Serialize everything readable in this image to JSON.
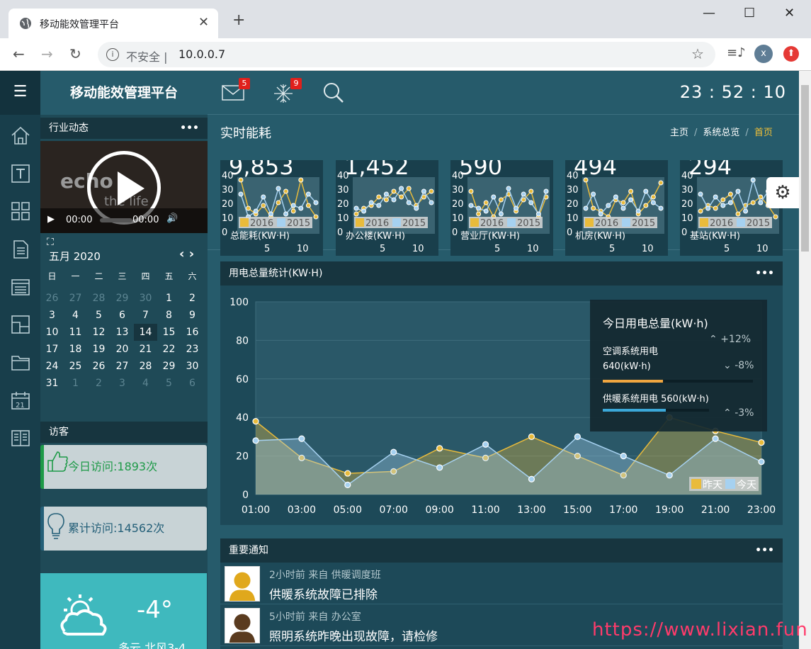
{
  "browser": {
    "tab_title": "移动能效管理平台",
    "insecure": "不安全",
    "url": "10.0.0.7",
    "avatar_initial": "x"
  },
  "app": {
    "brand": "移动能效管理平台",
    "clock": "23 : 52 : 10",
    "mail_badge": "5",
    "snow_badge": "9"
  },
  "page": {
    "title": "实时能耗",
    "breadcrumbs": [
      "主页",
      "系统总览",
      "首页"
    ]
  },
  "news": {
    "title": "行业动态",
    "video_time": "00:00",
    "video_duration": "00:00",
    "video_text": [
      "echo",
      "the life"
    ]
  },
  "calendar": {
    "month": "五月 2020",
    "weekdays": [
      "日",
      "一",
      "二",
      "三",
      "四",
      "五",
      "六"
    ],
    "rows": [
      [
        "26",
        "27",
        "28",
        "29",
        "30",
        "1",
        "2"
      ],
      [
        "3",
        "4",
        "5",
        "6",
        "7",
        "8",
        "9"
      ],
      [
        "10",
        "11",
        "12",
        "13",
        "14",
        "15",
        "16"
      ],
      [
        "17",
        "18",
        "19",
        "20",
        "21",
        "22",
        "23"
      ],
      [
        "24",
        "25",
        "26",
        "27",
        "28",
        "29",
        "30"
      ],
      [
        "31",
        "1",
        "2",
        "3",
        "4",
        "5",
        "6"
      ]
    ],
    "today": "14"
  },
  "visitors": {
    "title": "访客",
    "today": "今日访问:1893次",
    "total": "累计访问:14562次"
  },
  "weather": {
    "temp": "-4°",
    "desc": "多云 北风3-4"
  },
  "minis": [
    {
      "value": "9,853",
      "label": "总能耗(KW·H)",
      "s2016": [
        38,
        18,
        14,
        20,
        12,
        22,
        30,
        16,
        38,
        20,
        12
      ],
      "s2015": [
        28,
        12,
        16,
        26,
        14,
        32,
        14,
        20,
        18,
        28,
        22
      ]
    },
    {
      "value": "1,452",
      "label": "办公楼(KW·H)",
      "s2016": [
        14,
        18,
        20,
        26,
        24,
        30,
        26,
        32,
        20,
        26,
        30
      ],
      "s2015": [
        18,
        16,
        22,
        20,
        28,
        24,
        32,
        22,
        18,
        30,
        22
      ]
    },
    {
      "value": "590",
      "label": "营业厅(KW·H)",
      "s2016": [
        30,
        14,
        22,
        12,
        24,
        28,
        16,
        24,
        30,
        12,
        26
      ],
      "s2015": [
        20,
        18,
        16,
        26,
        14,
        32,
        18,
        28,
        22,
        14,
        30
      ]
    },
    {
      "value": "494",
      "label": "机房(KW·H)",
      "s2016": [
        38,
        18,
        16,
        12,
        24,
        22,
        30,
        14,
        20,
        26,
        36
      ],
      "s2015": [
        18,
        28,
        14,
        20,
        26,
        18,
        24,
        16,
        30,
        22,
        18
      ]
    },
    {
      "value": "294",
      "label": "基站(KW·H)",
      "s2016": [
        16,
        20,
        18,
        24,
        28,
        14,
        20,
        22,
        26,
        20,
        12
      ],
      "s2015": [
        28,
        18,
        26,
        20,
        22,
        30,
        16,
        38,
        22,
        30,
        24
      ]
    }
  ],
  "mini_axis": {
    "yticks": [
      "40",
      "30",
      "20",
      "10",
      "0"
    ],
    "xticks": [
      "5",
      "10"
    ],
    "legend": [
      "2016",
      "2015"
    ]
  },
  "chart_data": {
    "type": "area",
    "title": "用电总量统计(KW·H)",
    "x": [
      "01:00",
      "02:00",
      "03:00",
      "04:00",
      "05:00",
      "06:00",
      "07:00",
      "08:00",
      "09:00",
      "10:00",
      "11:00",
      "12:00",
      "13:00",
      "14:00",
      "15:00",
      "16:00",
      "17:00",
      "18:00",
      "19:00",
      "20:00",
      "21:00",
      "22:00",
      "23:00"
    ],
    "xticks": [
      "01:00",
      "03:00",
      "05:00",
      "07:00",
      "09:00",
      "11:00",
      "13:00",
      "15:00",
      "17:00",
      "19:00",
      "21:00",
      "23:00"
    ],
    "yticks": [
      "100",
      "80",
      "60",
      "40",
      "20",
      "0"
    ],
    "ylim": [
      0,
      100
    ],
    "series": [
      {
        "name": "昨天",
        "color": "#e9bb3b",
        "x": [
          "01:00",
          "03:00",
          "05:00",
          "07:00",
          "09:00",
          "11:00",
          "13:00",
          "15:00",
          "17:00",
          "19:00",
          "21:00",
          "23:00"
        ],
        "values": [
          38,
          19,
          11,
          12,
          24,
          19,
          30,
          20,
          10,
          40,
          33,
          27
        ]
      },
      {
        "name": "今天",
        "color": "#a6d1f0",
        "x": [
          "01:00",
          "03:00",
          "05:00",
          "07:00",
          "09:00",
          "11:00",
          "13:00",
          "15:00",
          "17:00",
          "19:00",
          "21:00",
          "23:00"
        ],
        "values": [
          28,
          29,
          5,
          22,
          14,
          26,
          8,
          30,
          20,
          10,
          29,
          17
        ]
      }
    ],
    "legend": "bottom-right"
  },
  "today_panel": {
    "title": "今日用电总量(kW·h)",
    "total_change": "+12%",
    "ac_label": "空调系统用电",
    "ac_value": "640(kW·h)",
    "ac_change": "-8%",
    "heat_label": "供暖系统用电 560(kW·h)",
    "heat_change": "-3%",
    "ac_fill": 0.4,
    "heat_fill": 0.42,
    "ac_color": "#f0a640",
    "heat_color": "#3ba8d8"
  },
  "notices": {
    "title": "重要通知",
    "items": [
      {
        "meta": "2小时前 来自 供暖调度班",
        "msg": "供暖系统故障已排除"
      },
      {
        "meta": "5小时前 来自 办公室",
        "msg": "照明系统昨晚出现故障，请检修"
      }
    ]
  },
  "watermark": "https://www.lixian.fun"
}
